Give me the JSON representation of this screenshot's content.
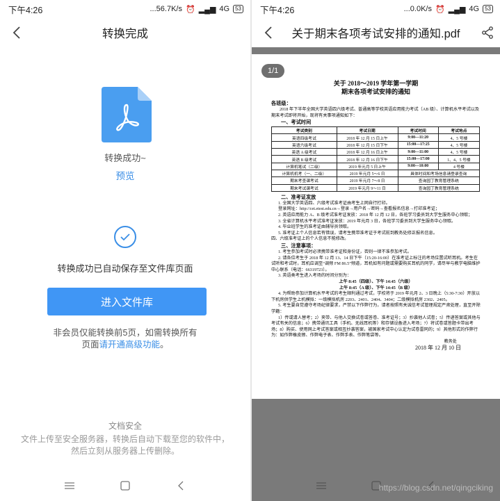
{
  "left": {
    "status": {
      "time": "下午4:26",
      "speed": "...56.7K/s",
      "net": "4G",
      "battery": "53"
    },
    "title": "转换完成",
    "convert_success": "转换成功~",
    "preview": "预览",
    "saved_note": "转换成功已自动保存至文件库页面",
    "library_button": "进入文件库",
    "member_line1": "非会员仅能转换前5页，如需转换所有",
    "member_line2_prefix": "页面",
    "member_link": "请开通高级功能",
    "member_line2_suffix": "。",
    "security_title": "文档安全",
    "security_line1": "文件上传至安全服务器，转换后自动下载至您的软件中，",
    "security_line2": "然后立刻从服务器上传删除。"
  },
  "right": {
    "status": {
      "time": "下午4:26",
      "speed": "...0.0K/s",
      "net": "4G",
      "battery": "53"
    },
    "title": "关于期末各项考试安排的通知.pdf",
    "page_badge": "1/1",
    "watermark": "https://blog.csdn.net/qingciking",
    "doc": {
      "title1": "关于 2018～2019 学年第一学期",
      "title2": "期末各项考试安排的通知",
      "greeting": "各班级：",
      "intro": "2018 年下半年全国大学英语四六级考试、普通高等学校英语应用能力考试（AB 级）、计算机水平考试以及期末考试即将开始，现将有关事项通知如下：",
      "sec1": "一、考试时间",
      "table_header": [
        "考试类别",
        "考试日期",
        "考试时间",
        "考试地点"
      ],
      "table_rows": [
        [
          "英语四级考试",
          "2018 年 12 月 15 日上午",
          "9:00—11:20",
          "4、5 号楼"
        ],
        [
          "英语六级考试",
          "2018 年 12 月 15 日下午",
          "15:00—17:25",
          "4、5 号楼"
        ],
        [
          "英语 A 级考试",
          "2018 年 12 月 16 日上午",
          "9:00—11:00",
          "4、5 号楼"
        ],
        [
          "英语 B 级考试",
          "2018 年 12 月 16 日下午",
          "15:00—17:00",
          "1、4、5 号楼"
        ],
        [
          "计算机笔试（二级）",
          "2019 年元月 5 日上午",
          "9:00—10:00",
          "4 号楼"
        ],
        [
          "计算机机考（一、二级）",
          "2019 年元月 5～6 日",
          "具体时间和考场信息请登录查询",
          ""
        ],
        [
          "期末考查课考试",
          "2019 年元月 7～8 日",
          "查询园丁教育管理系统",
          ""
        ],
        [
          "期末考试课考试",
          "2019 年元月 9～11 日",
          "查询园丁教育管理系统",
          ""
        ]
      ],
      "sec2": "二、准考证发放",
      "p2_1": "1. 全国大学英语四、六级考试准考证由考生上网自行打印。",
      "p2_1b": "登录网址：http://cet.etest.edu.cn→登录→用户名→密码→查看报名信息→打印准考证；",
      "p2_2": "2. 英语应用能力 A、B 级考试准考证发放：2018 年 12 月 12 日，各班学习委员到大学生服务中心领取；",
      "p2_3": "3. 全省计算机水平考试准考证发放：2019 年元月 3 日，各班学习委员到大学生服务中心领取。",
      "p2_4": "4. 毕业班学生的准考证由辅导员领取。",
      "p2_5": "5. 准考证上个人信息若有错误，请考生携带准考证于考试前到教务处修正报名信息。",
      "p2_6": "四、六级准考证上的个人信息不能修改。",
      "sec3": "三、注意事项：",
      "p3_1": "1. 考生参加考试时必须携带准考证和身份证，否则一律不准参加考试。",
      "p3_2": "2. 请各位考生于 2018 年 12 月 13、14 日下午（15:20-16:00）在准考证上标注的考场位置试听耳机。考生在试听和考试时，耳机应调至“调频 FM 86.5”频道，耳机如有问题或需要购买耳机的同学，请尽早与教学电脑维护中心联系（电话：66319723）。",
      "p3_3": "3. 英语类考生进入考场的时间分别为：",
      "p3_3a": "上午 8:45（四级）、下午 14:45（六级）",
      "p3_3b": "上午 8:45（A 级）、下午 14:45（B 级）",
      "p3_4": "4. 为帮助参加计算机水平考试的考生顺利通过考试，学校将于 2019 年元月 2、3 日晚上（5:30-7:30）开放以下机房供学生上机模拟：一级模拟机房 2203、2401、2404、3404；二级模拟机房 2302、2405。",
      "p3_5": "5. 考生要自觉遵守考场纪律要求，严禁以下作弊行为，请者按照有关诚信考试管理规定严肃处理，直至开除学籍：",
      "p3_5b": "1）传或请人替考；2）夹带、与他人交换试卷或答卷、准考证号；3）抄袭他人试卷；5）传递答案或其他与考试有关的信息；6）携带通讯工具（手机、无线耳机等）和存储设备进入考场；7）将试卷或答题卡带出考场；8）购买、使用网上考试答案或相互抄袭答案，被国家考试中心认定为试卷雷同的；9）其他形式的作弊行为：如作弊橡皮擦、作弊电子表、作弊手表、作弊笔袋等。",
      "sign": "教务处",
      "date": "2018 年 12 月 10 日"
    }
  }
}
